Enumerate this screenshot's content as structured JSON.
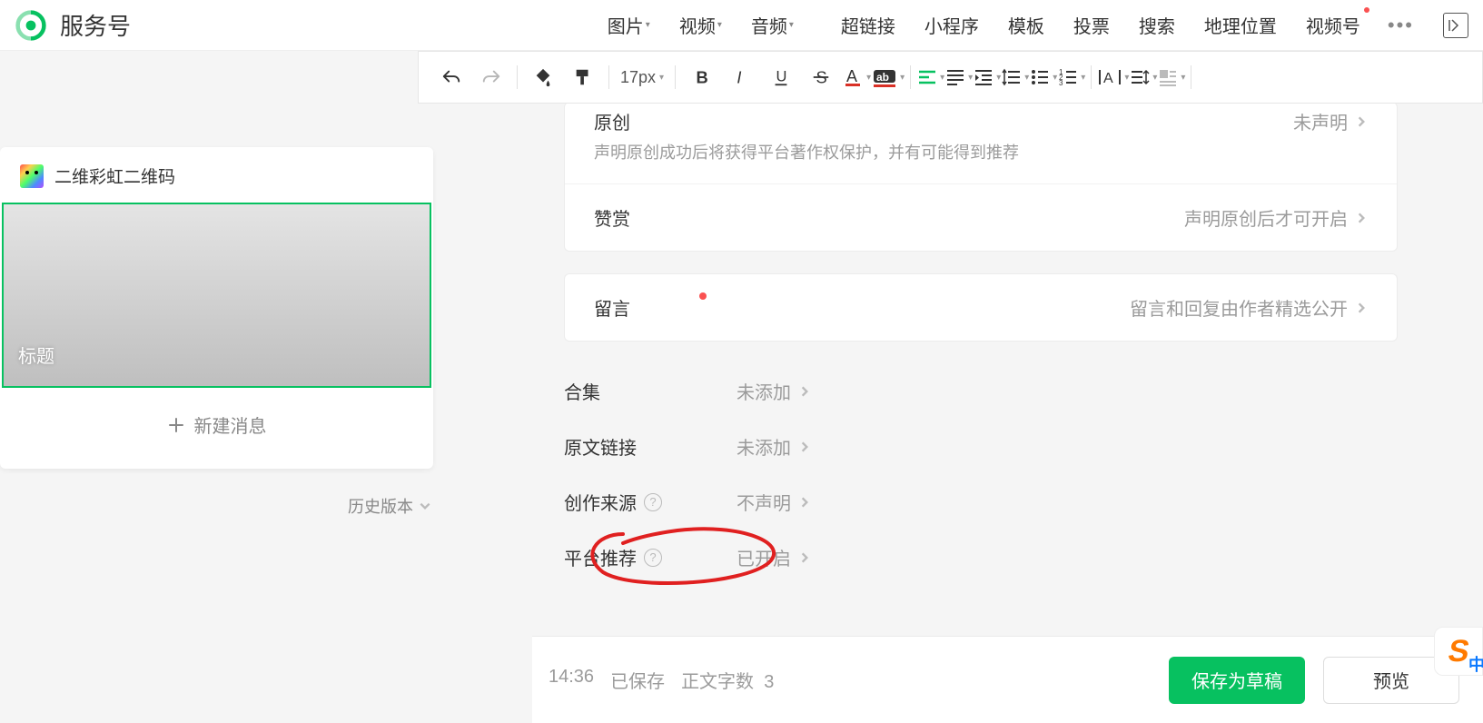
{
  "header": {
    "app_title": "服务号",
    "tabs": [
      "图片",
      "视频",
      "音频",
      "超链接",
      "小程序",
      "模板",
      "投票",
      "搜索",
      "地理位置",
      "视频号"
    ],
    "tabs_with_caret": [
      0,
      1,
      2
    ]
  },
  "toolbar": {
    "font_size": "17px"
  },
  "sidebar": {
    "account_name": "二维彩虹二维码",
    "article_placeholder": "标题",
    "new_message": "新建消息",
    "history": "历史版本"
  },
  "panels": {
    "original": {
      "label": "原创",
      "desc": "声明原创成功后将获得平台著作权保护，并有可能得到推荐",
      "status": "未声明"
    },
    "reward": {
      "label": "赞赏",
      "status": "声明原创后才可开启"
    },
    "comment": {
      "label": "留言",
      "status": "留言和回复由作者精选公开"
    }
  },
  "meta": {
    "collection": {
      "label": "合集",
      "value": "未添加"
    },
    "source_link": {
      "label": "原文链接",
      "value": "未添加"
    },
    "creation_source": {
      "label": "创作来源",
      "value": "不声明"
    },
    "platform_rec": {
      "label": "平台推荐",
      "value": "已开启"
    }
  },
  "footer": {
    "time": "14:36",
    "saved": "已保存",
    "wordcount_label": "正文字数",
    "wordcount": "3",
    "save_draft": "保存为草稿",
    "preview": "预览"
  }
}
